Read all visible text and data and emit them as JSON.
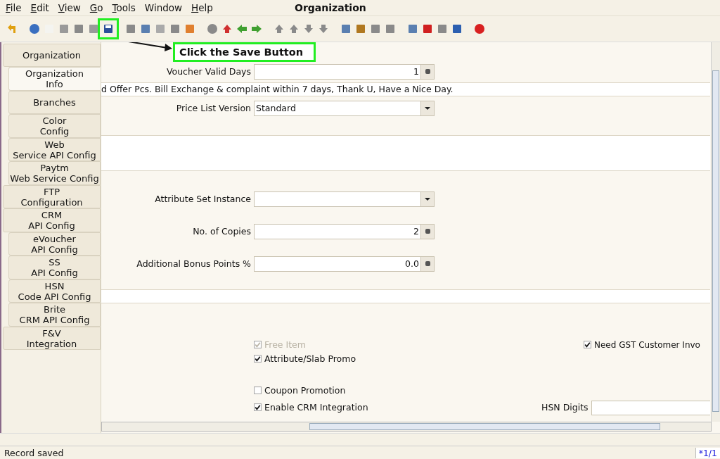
{
  "menu": [
    {
      "label": "File",
      "underlined": true
    },
    {
      "label": "Edit",
      "underlined": true
    },
    {
      "label": "View",
      "underlined": true
    },
    {
      "label": "Go",
      "underlined": true
    },
    {
      "label": "Tools",
      "underlined": true
    },
    {
      "label": "Window",
      "underlined": false
    },
    {
      "label": "Help",
      "underlined": true
    }
  ],
  "window": {
    "title": "Organization"
  },
  "callout": {
    "text": "Click the Save Button"
  },
  "tabs": [
    {
      "label": "Organization",
      "selected": false,
      "children": [
        {
          "label": "Organization\nInfo",
          "selected": true
        },
        {
          "label": "Branches",
          "selected": false
        },
        {
          "label": "Color\nConfig",
          "selected": false
        },
        {
          "label": "Web\nService API Config",
          "selected": false
        },
        {
          "label": "Paytm\nWeb Service Config",
          "selected": false
        }
      ]
    },
    {
      "label": "FTP\nConfiguration",
      "selected": false
    },
    {
      "label": "CRM\nAPI Config",
      "selected": false,
      "children": [
        {
          "label": "eVoucher\nAPI Config",
          "selected": false
        },
        {
          "label": "SS\nAPI Config",
          "selected": false
        },
        {
          "label": "HSN\nCode API Config",
          "selected": false
        },
        {
          "label": "Brite\nCRM API Config",
          "selected": false
        }
      ]
    },
    {
      "label": "F&V\nIntegration",
      "selected": false
    }
  ],
  "form": {
    "voucher_valid_days": {
      "label": "Voucher Valid Days",
      "value": "1"
    },
    "footer_text": {
      "value": "d Offer Pcs. Bill Exchange & complaint within 7 days, Thank U, Have a Nice Day."
    },
    "price_list_version": {
      "label": "Price List Version",
      "value": "Standard"
    },
    "attribute_set_instance": {
      "label": "Attribute Set Instance"
    },
    "copies": {
      "label": "No. of Copies",
      "value": "2"
    },
    "bonus_points": {
      "label": "Additional Bonus Points %",
      "value": "0.0"
    },
    "free_item": {
      "label": "Free Item",
      "checked": true,
      "disabled": true
    },
    "need_gst": {
      "label": "Need GST Customer Invo",
      "checked": true,
      "disabled": false
    },
    "slab_promo": {
      "label": "Attribute/Slab Promo",
      "checked": true,
      "disabled": false
    },
    "coupon_promotion": {
      "label": "Coupon Promotion",
      "checked": false,
      "disabled": false
    },
    "crm_integration": {
      "label": "Enable CRM Integration",
      "checked": true,
      "disabled": false
    },
    "hsn_digits": {
      "label": "HSN Digits"
    }
  },
  "status_bar": {
    "message": "Record saved",
    "record": "*1/1"
  }
}
